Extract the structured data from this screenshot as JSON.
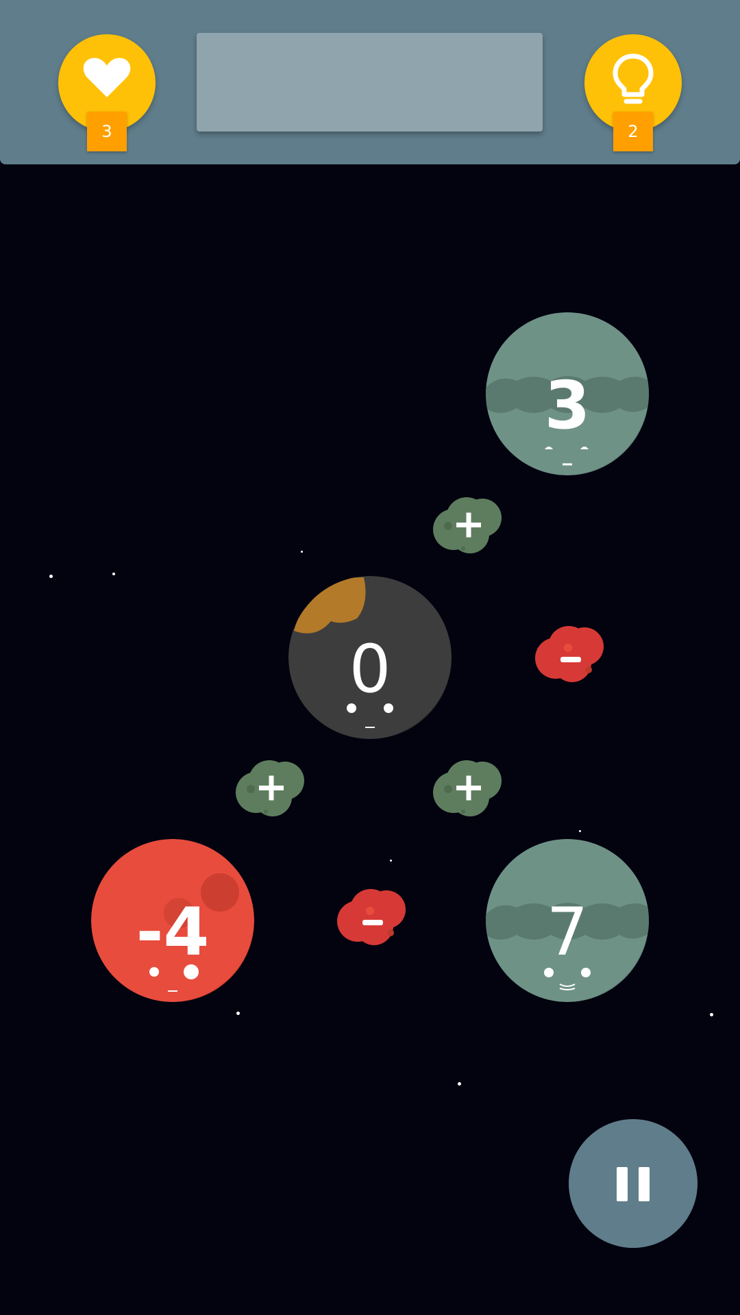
{
  "header": {
    "lives": {
      "icon": "heart-icon",
      "count": "3"
    },
    "hints": {
      "icon": "lightbulb-icon",
      "count": "2"
    },
    "target_display": ""
  },
  "planets": [
    {
      "value": "3",
      "color": "#6f9287",
      "style": "green-clouds"
    },
    {
      "value": "0",
      "color": "#3d3d3d",
      "style": "dark-with-orange-spot"
    },
    {
      "value": "-4",
      "color": "#e84c3d",
      "style": "red-craters"
    },
    {
      "value": "7",
      "color": "#6f9287",
      "style": "green-clouds"
    }
  ],
  "operators": [
    {
      "symbol": "+",
      "color": "#5e7d5e"
    },
    {
      "symbol": "-",
      "color": "#d73a36"
    },
    {
      "symbol": "+",
      "color": "#5e7d5e"
    },
    {
      "symbol": "+",
      "color": "#5e7d5e"
    },
    {
      "symbol": "-",
      "color": "#d73a36"
    }
  ],
  "controls": {
    "pause_icon": "pause-icon"
  },
  "colors": {
    "background": "#03030f",
    "top_bar": "#607d8b",
    "counter": "#ffc107",
    "badge": "#ffa000",
    "target_box": "#90a4ae"
  }
}
